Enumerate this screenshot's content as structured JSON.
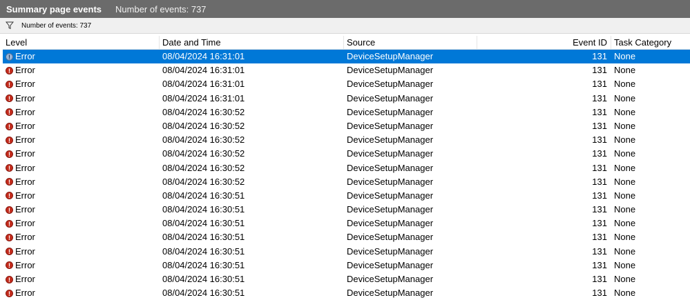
{
  "title_bar": {
    "title": "Summary page events",
    "count_label": "Number of events: 737"
  },
  "filter_bar": {
    "icon": "filter-icon",
    "text": "Number of events: 737"
  },
  "columns": {
    "level": "Level",
    "date_time": "Date and Time",
    "source": "Source",
    "event_id": "Event ID",
    "task_category": "Task Category"
  },
  "colors": {
    "selection": "#0078d7",
    "error_icon": "#c42b1c",
    "title_bar": "#6b6b6b"
  },
  "rows": [
    {
      "level": "Error",
      "date": "08/04/2024 16:31:01",
      "source": "DeviceSetupManager",
      "event_id": "131",
      "task": "None",
      "selected": true
    },
    {
      "level": "Error",
      "date": "08/04/2024 16:31:01",
      "source": "DeviceSetupManager",
      "event_id": "131",
      "task": "None"
    },
    {
      "level": "Error",
      "date": "08/04/2024 16:31:01",
      "source": "DeviceSetupManager",
      "event_id": "131",
      "task": "None"
    },
    {
      "level": "Error",
      "date": "08/04/2024 16:31:01",
      "source": "DeviceSetupManager",
      "event_id": "131",
      "task": "None"
    },
    {
      "level": "Error",
      "date": "08/04/2024 16:30:52",
      "source": "DeviceSetupManager",
      "event_id": "131",
      "task": "None"
    },
    {
      "level": "Error",
      "date": "08/04/2024 16:30:52",
      "source": "DeviceSetupManager",
      "event_id": "131",
      "task": "None"
    },
    {
      "level": "Error",
      "date": "08/04/2024 16:30:52",
      "source": "DeviceSetupManager",
      "event_id": "131",
      "task": "None"
    },
    {
      "level": "Error",
      "date": "08/04/2024 16:30:52",
      "source": "DeviceSetupManager",
      "event_id": "131",
      "task": "None"
    },
    {
      "level": "Error",
      "date": "08/04/2024 16:30:52",
      "source": "DeviceSetupManager",
      "event_id": "131",
      "task": "None"
    },
    {
      "level": "Error",
      "date": "08/04/2024 16:30:52",
      "source": "DeviceSetupManager",
      "event_id": "131",
      "task": "None"
    },
    {
      "level": "Error",
      "date": "08/04/2024 16:30:51",
      "source": "DeviceSetupManager",
      "event_id": "131",
      "task": "None"
    },
    {
      "level": "Error",
      "date": "08/04/2024 16:30:51",
      "source": "DeviceSetupManager",
      "event_id": "131",
      "task": "None"
    },
    {
      "level": "Error",
      "date": "08/04/2024 16:30:51",
      "source": "DeviceSetupManager",
      "event_id": "131",
      "task": "None"
    },
    {
      "level": "Error",
      "date": "08/04/2024 16:30:51",
      "source": "DeviceSetupManager",
      "event_id": "131",
      "task": "None"
    },
    {
      "level": "Error",
      "date": "08/04/2024 16:30:51",
      "source": "DeviceSetupManager",
      "event_id": "131",
      "task": "None"
    },
    {
      "level": "Error",
      "date": "08/04/2024 16:30:51",
      "source": "DeviceSetupManager",
      "event_id": "131",
      "task": "None"
    },
    {
      "level": "Error",
      "date": "08/04/2024 16:30:51",
      "source": "DeviceSetupManager",
      "event_id": "131",
      "task": "None"
    },
    {
      "level": "Error",
      "date": "08/04/2024 16:30:51",
      "source": "DeviceSetupManager",
      "event_id": "131",
      "task": "None"
    }
  ]
}
